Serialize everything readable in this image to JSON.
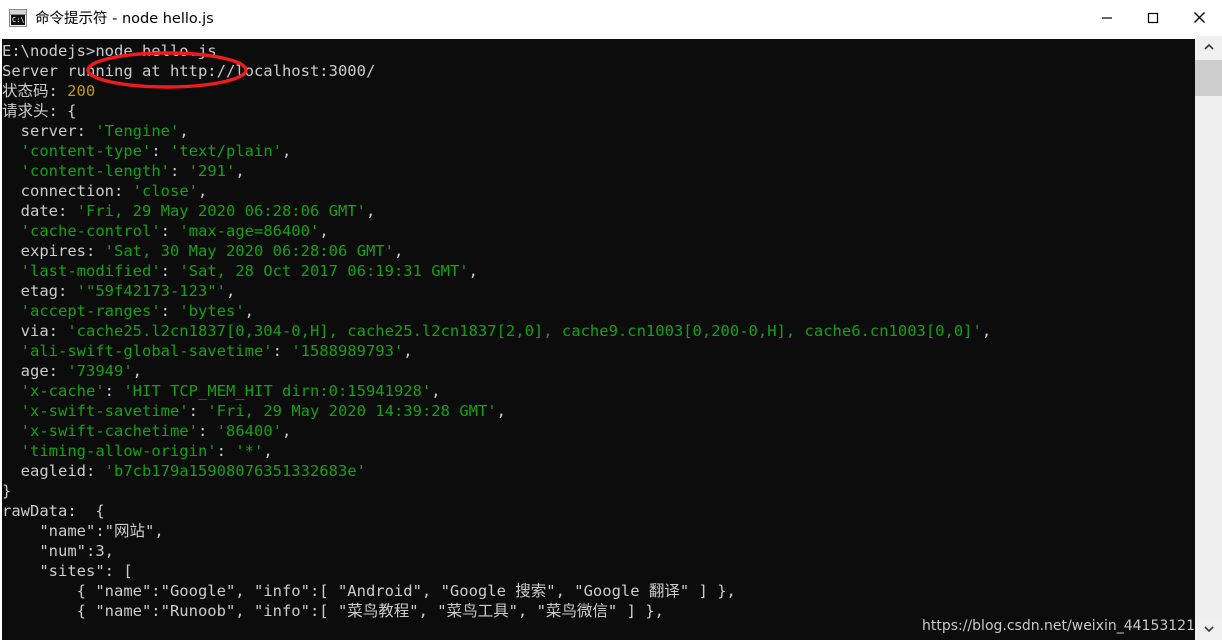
{
  "window": {
    "title": "命令提示符 - node hello.js",
    "icon_name": "cmd-icon",
    "icon_text": "C:\\",
    "controls": {
      "minimize_label": "最小化",
      "maximize_label": "最大化",
      "close_label": "关闭"
    }
  },
  "colors": {
    "console_bg": "#0c0c0c",
    "text_white": "#cccccc",
    "text_green": "#12a312",
    "text_yellow": "#c19c00",
    "annotation_red": "#ee1c1c",
    "titlebar_bg": "#ffffff",
    "scrollbar_bg": "#efefef",
    "scrollbar_thumb": "#cdcdcd"
  },
  "annotation": {
    "name": "red-ellipse-highlight",
    "targets": "node hello.js"
  },
  "scrollbar": {
    "up_arrow": "⌃",
    "down_arrow": "⌄",
    "thumb_position_pct": 4
  },
  "watermark": {
    "text": "https://blog.csdn.net/weixin_44153121"
  },
  "terminal": {
    "lines": [
      [
        {
          "t": "E:\\nodejs>node hello.js",
          "c": "w"
        }
      ],
      [
        {
          "t": "Server running at http://localhost:3000/",
          "c": "w"
        }
      ],
      [
        {
          "t": "状态码: ",
          "c": "w"
        },
        {
          "t": "200",
          "c": "y"
        }
      ],
      [
        {
          "t": "请求头: {",
          "c": "w"
        }
      ],
      [
        {
          "t": "  server: ",
          "c": "w"
        },
        {
          "t": "'Tengine'",
          "c": "g"
        },
        {
          "t": ",",
          "c": "w"
        }
      ],
      [
        {
          "t": "  ",
          "c": "w"
        },
        {
          "t": "'content-type'",
          "c": "g"
        },
        {
          "t": ": ",
          "c": "w"
        },
        {
          "t": "'text/plain'",
          "c": "g"
        },
        {
          "t": ",",
          "c": "w"
        }
      ],
      [
        {
          "t": "  ",
          "c": "w"
        },
        {
          "t": "'content-length'",
          "c": "g"
        },
        {
          "t": ": ",
          "c": "w"
        },
        {
          "t": "'291'",
          "c": "g"
        },
        {
          "t": ",",
          "c": "w"
        }
      ],
      [
        {
          "t": "  connection: ",
          "c": "w"
        },
        {
          "t": "'close'",
          "c": "g"
        },
        {
          "t": ",",
          "c": "w"
        }
      ],
      [
        {
          "t": "  date: ",
          "c": "w"
        },
        {
          "t": "'Fri, 29 May 2020 06:28:06 GMT'",
          "c": "g"
        },
        {
          "t": ",",
          "c": "w"
        }
      ],
      [
        {
          "t": "  ",
          "c": "w"
        },
        {
          "t": "'cache-control'",
          "c": "g"
        },
        {
          "t": ": ",
          "c": "w"
        },
        {
          "t": "'max-age=86400'",
          "c": "g"
        },
        {
          "t": ",",
          "c": "w"
        }
      ],
      [
        {
          "t": "  expires: ",
          "c": "w"
        },
        {
          "t": "'Sat, 30 May 2020 06:28:06 GMT'",
          "c": "g"
        },
        {
          "t": ",",
          "c": "w"
        }
      ],
      [
        {
          "t": "  ",
          "c": "w"
        },
        {
          "t": "'last-modified'",
          "c": "g"
        },
        {
          "t": ": ",
          "c": "w"
        },
        {
          "t": "'Sat, 28 Oct 2017 06:19:31 GMT'",
          "c": "g"
        },
        {
          "t": ",",
          "c": "w"
        }
      ],
      [
        {
          "t": "  etag: ",
          "c": "w"
        },
        {
          "t": "'\"59f42173-123\"'",
          "c": "g"
        },
        {
          "t": ",",
          "c": "w"
        }
      ],
      [
        {
          "t": "  ",
          "c": "w"
        },
        {
          "t": "'accept-ranges'",
          "c": "g"
        },
        {
          "t": ": ",
          "c": "w"
        },
        {
          "t": "'bytes'",
          "c": "g"
        },
        {
          "t": ",",
          "c": "w"
        }
      ],
      [
        {
          "t": "  via: ",
          "c": "w"
        },
        {
          "t": "'cache25.l2cn1837[0,304-0,H], cache25.l2cn1837[2,0], cache9.cn1003[0,200-0,H], cache6.cn1003[0,0]'",
          "c": "g"
        },
        {
          "t": ",",
          "c": "w"
        }
      ],
      [
        {
          "t": "  ",
          "c": "w"
        },
        {
          "t": "'ali-swift-global-savetime'",
          "c": "g"
        },
        {
          "t": ": ",
          "c": "w"
        },
        {
          "t": "'1588989793'",
          "c": "g"
        },
        {
          "t": ",",
          "c": "w"
        }
      ],
      [
        {
          "t": "  age: ",
          "c": "w"
        },
        {
          "t": "'73949'",
          "c": "g"
        },
        {
          "t": ",",
          "c": "w"
        }
      ],
      [
        {
          "t": "  ",
          "c": "w"
        },
        {
          "t": "'x-cache'",
          "c": "g"
        },
        {
          "t": ": ",
          "c": "w"
        },
        {
          "t": "'HIT TCP_MEM_HIT dirn:0:15941928'",
          "c": "g"
        },
        {
          "t": ",",
          "c": "w"
        }
      ],
      [
        {
          "t": "  ",
          "c": "w"
        },
        {
          "t": "'x-swift-savetime'",
          "c": "g"
        },
        {
          "t": ": ",
          "c": "w"
        },
        {
          "t": "'Fri, 29 May 2020 14:39:28 GMT'",
          "c": "g"
        },
        {
          "t": ",",
          "c": "w"
        }
      ],
      [
        {
          "t": "  ",
          "c": "w"
        },
        {
          "t": "'x-swift-cachetime'",
          "c": "g"
        },
        {
          "t": ": ",
          "c": "w"
        },
        {
          "t": "'86400'",
          "c": "g"
        },
        {
          "t": ",",
          "c": "w"
        }
      ],
      [
        {
          "t": "  ",
          "c": "w"
        },
        {
          "t": "'timing-allow-origin'",
          "c": "g"
        },
        {
          "t": ": ",
          "c": "w"
        },
        {
          "t": "'*'",
          "c": "g"
        },
        {
          "t": ",",
          "c": "w"
        }
      ],
      [
        {
          "t": "  eagleid: ",
          "c": "w"
        },
        {
          "t": "'b7cb179a15908076351332683e'",
          "c": "g"
        }
      ],
      [
        {
          "t": "}",
          "c": "w"
        }
      ],
      [
        {
          "t": "rawData:  {",
          "c": "w"
        }
      ],
      [
        {
          "t": "    \"name\":\"网站\",",
          "c": "w"
        }
      ],
      [
        {
          "t": "    \"num\":3,",
          "c": "w"
        }
      ],
      [
        {
          "t": "    \"sites\": [",
          "c": "w"
        }
      ],
      [
        {
          "t": "        { \"name\":\"Google\", \"info\":[ \"Android\", \"Google 搜索\", \"Google 翻译\" ] },",
          "c": "w"
        }
      ],
      [
        {
          "t": "        { \"name\":\"Runoob\", \"info\":[ \"菜鸟教程\", \"菜鸟工具\", \"菜鸟微信\" ] },",
          "c": "w"
        }
      ]
    ]
  }
}
